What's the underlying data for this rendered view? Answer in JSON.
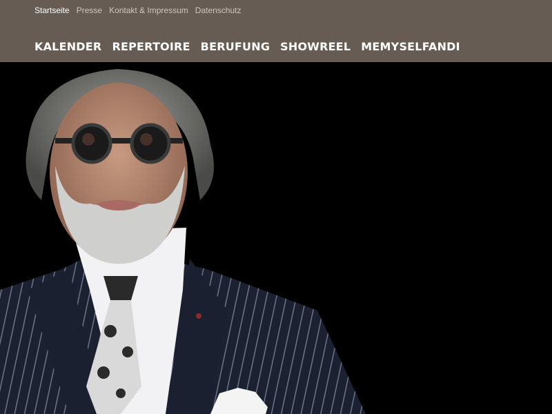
{
  "header": {
    "top_links": [
      {
        "label": "Startseite",
        "active": true
      },
      {
        "label": "Presse",
        "active": false
      },
      {
        "label": "Kontakt & Impressum",
        "active": false
      },
      {
        "label": "Datenschutz",
        "active": false
      }
    ],
    "main_nav": [
      {
        "label": "KALENDER"
      },
      {
        "label": "REPERTOIRE"
      },
      {
        "label": "BERUFUNG"
      },
      {
        "label": "SHOWREEL"
      },
      {
        "label": "MEMYSELFANDI"
      }
    ]
  },
  "colors": {
    "header_bg": "#665c54",
    "hero_bg": "#000000",
    "link_inactive": "#cfc6bd",
    "link_active": "#ffffff"
  },
  "hero": {
    "icon": "portrait-photo"
  }
}
